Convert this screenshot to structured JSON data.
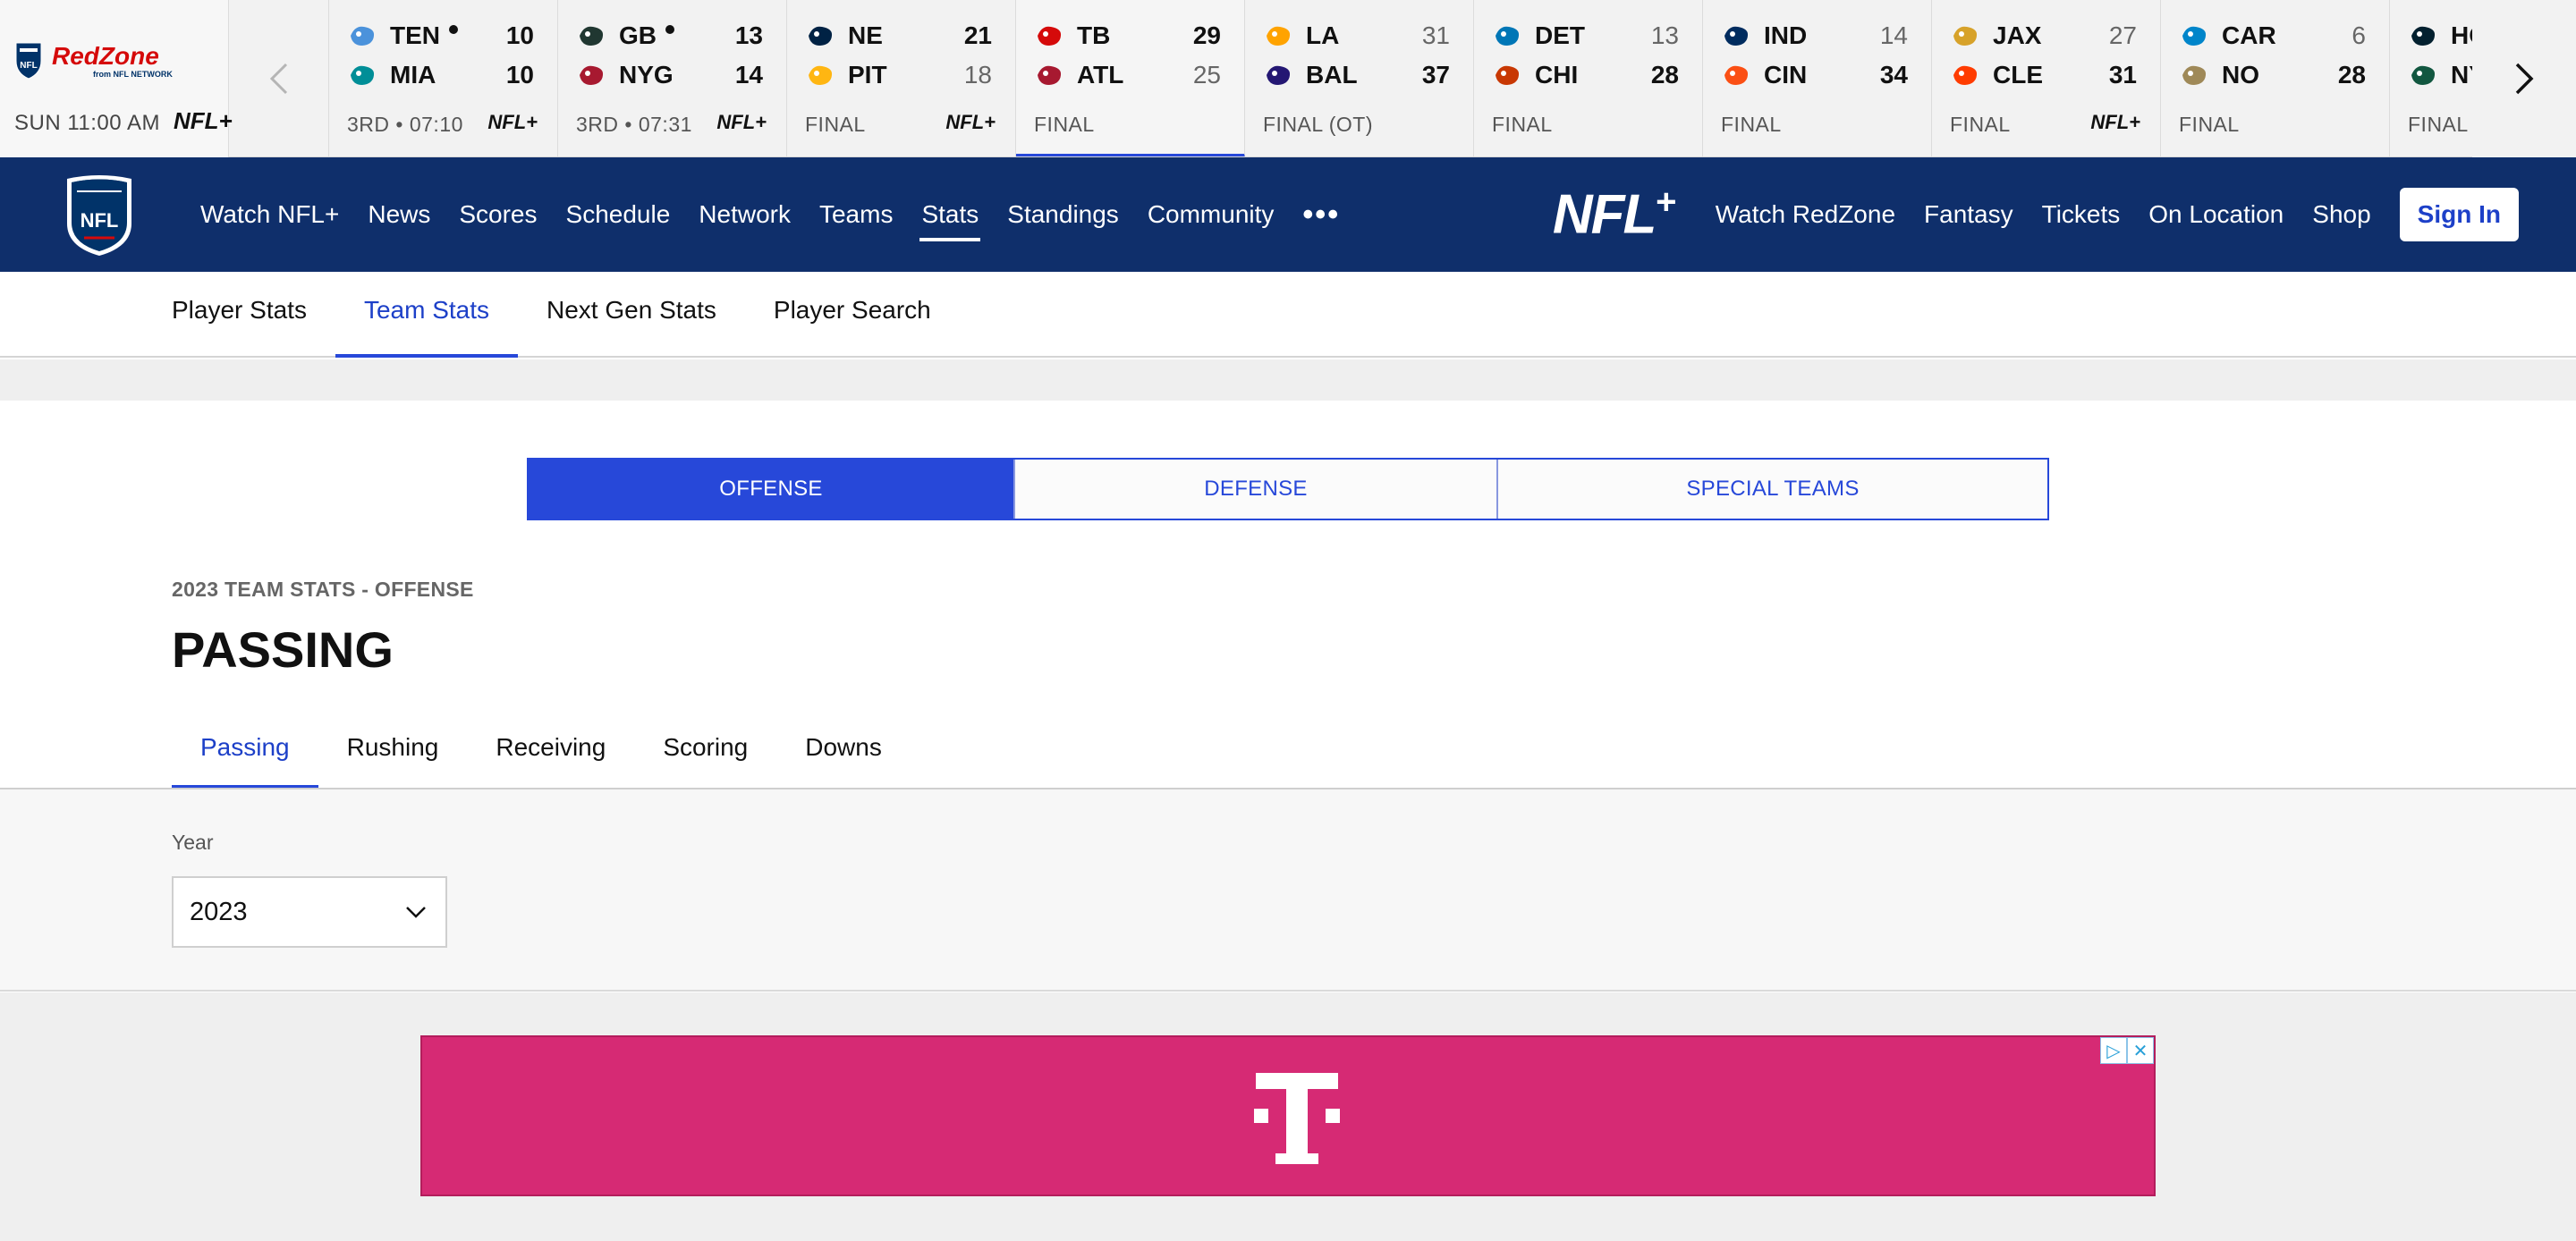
{
  "redzone": {
    "logo_text": "RedZone",
    "logo_subtext": "from NFL NETWORK",
    "time": "SUN 11:00 AM",
    "plus_label": "NFL+"
  },
  "games": [
    {
      "team1": "TEN",
      "score1": "10",
      "team2": "MIA",
      "score2": "10",
      "status": "3RD • 07:10",
      "plus": "NFL+",
      "possession": 1,
      "loser": 0,
      "logo1": "titans-icon",
      "logo2": "dolphins-icon",
      "c1": "#4b92db",
      "c2": "#008e97"
    },
    {
      "team1": "GB",
      "score1": "13",
      "team2": "NYG",
      "score2": "14",
      "status": "3RD • 07:31",
      "plus": "NFL+",
      "possession": 1,
      "loser": 0,
      "logo1": "packers-icon",
      "logo2": "giants-icon",
      "c1": "#203731",
      "c2": "#a71930"
    },
    {
      "team1": "NE",
      "score1": "21",
      "team2": "PIT",
      "score2": "18",
      "status": "FINAL",
      "plus": "NFL+",
      "possession": 0,
      "loser": 2,
      "logo1": "patriots-icon",
      "logo2": "steelers-icon",
      "c1": "#002244",
      "c2": "#ffb612"
    },
    {
      "team1": "TB",
      "score1": "29",
      "team2": "ATL",
      "score2": "25",
      "status": "FINAL",
      "plus": "",
      "possession": 0,
      "loser": 2,
      "logo1": "buccaneers-icon",
      "logo2": "falcons-icon",
      "c1": "#d50a0a",
      "c2": "#a71930"
    },
    {
      "team1": "LA",
      "score1": "31",
      "team2": "BAL",
      "score2": "37",
      "status": "FINAL (OT)",
      "plus": "",
      "possession": 0,
      "loser": 1,
      "logo1": "rams-icon",
      "logo2": "ravens-icon",
      "c1": "#ffa300",
      "c2": "#241773"
    },
    {
      "team1": "DET",
      "score1": "13",
      "team2": "CHI",
      "score2": "28",
      "status": "FINAL",
      "plus": "",
      "possession": 0,
      "loser": 1,
      "logo1": "lions-icon",
      "logo2": "bears-icon",
      "c1": "#0076b6",
      "c2": "#c83803"
    },
    {
      "team1": "IND",
      "score1": "14",
      "team2": "CIN",
      "score2": "34",
      "status": "FINAL",
      "plus": "",
      "possession": 0,
      "loser": 1,
      "logo1": "colts-icon",
      "logo2": "bengals-icon",
      "c1": "#002c5f",
      "c2": "#fb4f14"
    },
    {
      "team1": "JAX",
      "score1": "27",
      "team2": "CLE",
      "score2": "31",
      "status": "FINAL",
      "plus": "NFL+",
      "possession": 0,
      "loser": 1,
      "logo1": "jaguars-icon",
      "logo2": "browns-icon",
      "c1": "#d7a22a",
      "c2": "#ff3c00"
    },
    {
      "team1": "CAR",
      "score1": "6",
      "team2": "NO",
      "score2": "28",
      "status": "FINAL",
      "plus": "",
      "possession": 0,
      "loser": 1,
      "logo1": "panthers-icon",
      "logo2": "saints-icon",
      "c1": "#0085ca",
      "c2": "#9f8958"
    },
    {
      "team1": "HOU",
      "score1": "",
      "team2": "NYJ",
      "score2": "",
      "status": "FINAL",
      "plus": "",
      "possession": 0,
      "loser": 0,
      "logo1": "texans-icon",
      "logo2": "jets-icon",
      "c1": "#03202f",
      "c2": "#125740"
    }
  ],
  "nav": {
    "items": [
      "Watch NFL+",
      "News",
      "Scores",
      "Schedule",
      "Network",
      "Teams",
      "Stats",
      "Standings",
      "Community"
    ],
    "active": "Stats",
    "more": "•••",
    "plus_logo": "NFL",
    "right_items": [
      "Watch RedZone",
      "Fantasy",
      "Tickets",
      "On Location",
      "Shop"
    ],
    "sign_in": "Sign In"
  },
  "subnav": {
    "items": [
      "Player Stats",
      "Team Stats",
      "Next Gen Stats",
      "Player Search"
    ],
    "active": "Team Stats"
  },
  "categories": {
    "items": [
      "OFFENSE",
      "DEFENSE",
      "SPECIAL TEAMS"
    ],
    "active": "OFFENSE"
  },
  "season_label": "2023 TEAM STATS - OFFENSE",
  "page_title": "PASSING",
  "stat_tabs": {
    "items": [
      "Passing",
      "Rushing",
      "Receiving",
      "Scoring",
      "Downs"
    ],
    "active": "Passing"
  },
  "year_filter": {
    "label": "Year",
    "value": "2023"
  },
  "ad": {
    "brand_icon": "t-mobile-logo",
    "bg_color": "#d62a74"
  },
  "colors": {
    "nav_bg": "#0f2f6b",
    "accent": "#2748d9"
  }
}
